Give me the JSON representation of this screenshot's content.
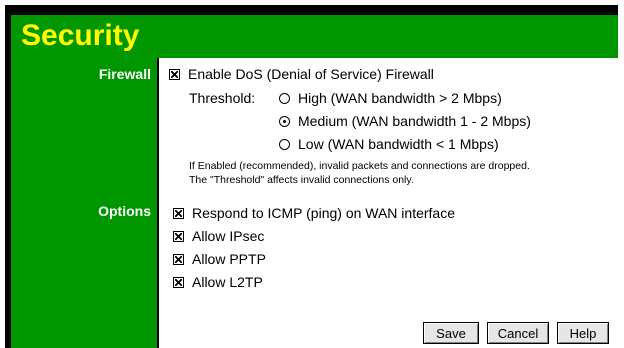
{
  "header": {
    "title": "Security"
  },
  "labels": {
    "firewall": "Firewall",
    "options": "Options"
  },
  "firewall": {
    "dos_label": "Enable DoS (Denial of Service) Firewall",
    "dos_checked": true,
    "threshold_label": "Threshold:",
    "threshold_options": [
      {
        "label": "High (WAN bandwidth > 2 Mbps)",
        "selected": false
      },
      {
        "label": "Medium (WAN bandwidth 1 - 2 Mbps)",
        "selected": true
      },
      {
        "label": "Low (WAN bandwidth < 1 Mbps)",
        "selected": false
      }
    ],
    "note_line1": "If Enabled (recommended), invalid packets and connections are dropped.",
    "note_line2": "The \"Threshold\" affects invalid connections only."
  },
  "options": {
    "items": [
      {
        "label": "Respond to ICMP (ping) on WAN interface",
        "checked": true
      },
      {
        "label": "Allow IPsec",
        "checked": true
      },
      {
        "label": "Allow PPTP",
        "checked": true
      },
      {
        "label": "Allow L2TP",
        "checked": true
      }
    ]
  },
  "buttons": {
    "save": "Save",
    "cancel": "Cancel",
    "help": "Help"
  },
  "colors": {
    "header_bg": "#009600",
    "title_text": "#ffff00",
    "frame": "#000000"
  }
}
